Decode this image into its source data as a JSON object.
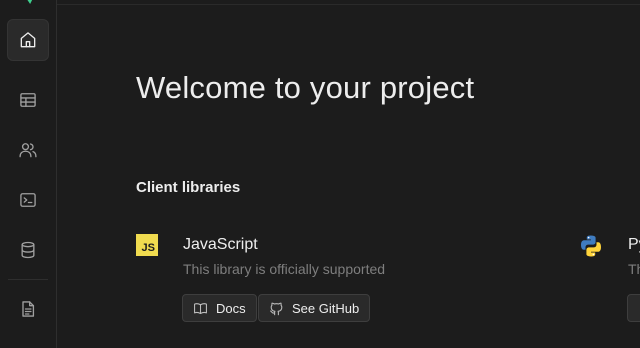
{
  "sidebar": {
    "items": [
      {
        "name": "home",
        "icon": "home-icon",
        "active": true
      },
      {
        "name": "table-editor",
        "icon": "table-icon",
        "active": false
      },
      {
        "name": "authentication",
        "icon": "users-icon",
        "active": false
      },
      {
        "name": "sql-editor",
        "icon": "terminal-icon",
        "active": false
      },
      {
        "name": "database",
        "icon": "database-icon",
        "active": false
      },
      {
        "name": "api-docs",
        "icon": "file-text-icon",
        "active": false
      }
    ]
  },
  "main": {
    "title": "Welcome to your project",
    "section_title": "Client libraries",
    "libraries": [
      {
        "name": "JavaScript",
        "logo_text": "JS",
        "description": "This library is officially supported",
        "buttons": [
          {
            "label": "Docs",
            "icon": "book-icon"
          },
          {
            "label": "See GitHub",
            "icon": "github-icon"
          }
        ]
      },
      {
        "name": "Py",
        "logo_icon": "python-icon",
        "description": "Th"
      }
    ]
  },
  "colors": {
    "background": "#1c1c1c",
    "text": "#ededed",
    "muted": "#7e7e7e",
    "js_yellow": "#f0db4f",
    "python_blue": "#3f7cc0",
    "python_yellow": "#ffd43b"
  }
}
